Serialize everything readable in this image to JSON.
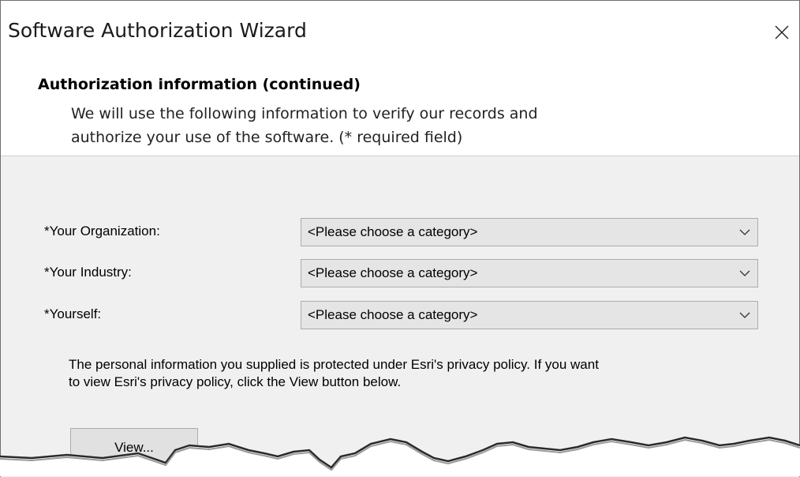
{
  "window": {
    "title": "Software Authorization Wizard"
  },
  "header": {
    "heading": "Authorization information (continued)",
    "description_line1": "We will use the following information to verify our records and",
    "description_line2": "authorize your use of the software. (* required field)"
  },
  "form": {
    "fields": [
      {
        "label": "*Your Organization:",
        "value": "<Please choose a category>"
      },
      {
        "label": "*Your Industry:",
        "value": "<Please choose a category>"
      },
      {
        "label": "*Yourself:",
        "value": "<Please choose a category>"
      }
    ]
  },
  "privacy": {
    "line1": "The personal information you supplied is protected under Esri's privacy policy. If you want",
    "line2": "to view Esri's privacy policy, click the View button below."
  },
  "buttons": {
    "view_label": "View..."
  },
  "icons": {
    "close": "close-icon",
    "dropdown": "chevron-down-icon"
  }
}
